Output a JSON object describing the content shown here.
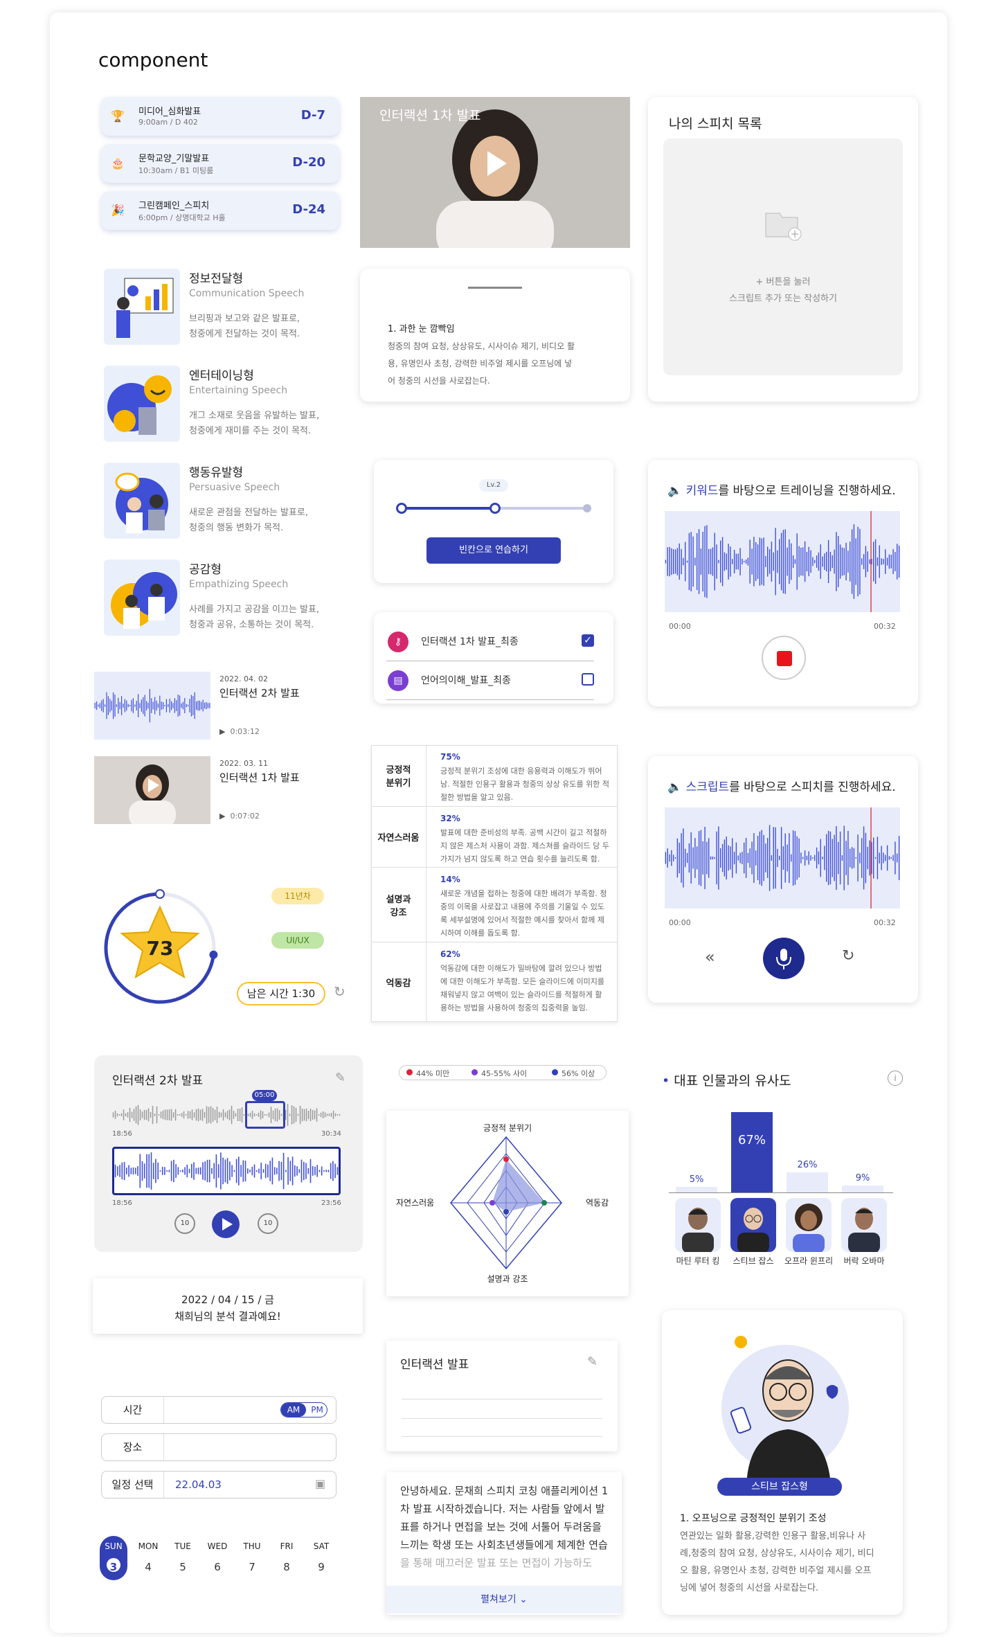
{
  "header": {
    "title": "component"
  },
  "schedules": [
    {
      "name": "미디어_심화발표",
      "sub": "9:00am / D 402",
      "dday": "D-7",
      "icon": "trophy-icon"
    },
    {
      "name": "문학교양_기말발표",
      "sub": "10:30am / B1 미팅룸",
      "dday": "D-20",
      "icon": "cake-icon"
    },
    {
      "name": "그린캠페인_스피치",
      "sub": "6:00pm / 상명대학교 H홀",
      "dday": "D-24",
      "icon": "party-icon"
    }
  ],
  "speech_types": [
    {
      "title": "정보전달형",
      "en": "Communication Speech",
      "desc1": "브리핑과 보고와 같은 발표로,",
      "desc2": "청중에게 전달하는 것이 목적."
    },
    {
      "title": "엔터테이닝형",
      "en": "Entertaining Speech",
      "desc1": "개그 소재로 웃음을 유발하는 발표,",
      "desc2": "청중에게 재미를 주는 것이 목적."
    },
    {
      "title": "행동유발형",
      "en": "Persuasive Speech",
      "desc1": "새로운 관점을 전달하는 발표로,",
      "desc2": "청중의 행동 변화가 목적."
    },
    {
      "title": "공감형",
      "en": "Empathizing Speech",
      "desc1": "사례를 가지고 공감을 이끄는 발표,",
      "desc2": "청중과 공유, 소통하는 것이 목적."
    }
  ],
  "recordings": [
    {
      "date": "2022. 04. 02",
      "title": "인터랙션 2차 발표",
      "duration": "0:03:12"
    },
    {
      "date": "2022. 03. 11",
      "title": "인터랙션 1차 발표",
      "duration": "0:07:02"
    }
  ],
  "score": {
    "value": "73",
    "level": 0.73
  },
  "tags": {
    "grade": "11년차",
    "category": "UI/UX",
    "remaining": "남은 시간 1:30"
  },
  "editor": {
    "title": "인터랙션 2차 발표",
    "badge": "05:00",
    "t1_start": "18:56",
    "t1_end": "30:34",
    "t2_start": "18:56",
    "t2_end": "23:56",
    "rewind": "10",
    "forward": "10"
  },
  "result_card": {
    "date": "2022 / 04 / 15 / 금",
    "msg": "채희님의 분석 결과예요!"
  },
  "form": {
    "time_label": "시간",
    "am": "AM",
    "pm": "PM",
    "place_label": "장소",
    "date_label": "일정 선택",
    "date_value": "22.04.03"
  },
  "calendar": {
    "days": [
      "SUN",
      "MON",
      "TUE",
      "WED",
      "THU",
      "FRI",
      "SAT"
    ],
    "nums": [
      "3",
      "4",
      "5",
      "6",
      "7",
      "8",
      "9"
    ]
  },
  "video": {
    "title": "인터랙션 1차 발표"
  },
  "tip_card": {
    "title": "1. 과한 눈 깜빡임",
    "l1": "청중의 참여 요청, 상상유도, 시사이슈 제기, 비디오 활",
    "l2": "용, 유명인사 초청, 강력한 비주얼 제시를 오프닝에 넣",
    "l3": "어 청중의 시선을 사로잡는다."
  },
  "level": {
    "label": "Lv.2",
    "button": "빈칸으로 연습하기",
    "progress": 0.5
  },
  "checklist": [
    {
      "label": "인터랙션 1차 발표_최종",
      "checked": true,
      "icon": "key-icon"
    },
    {
      "label": "언어의이해_발표_최종",
      "checked": false,
      "icon": "doc-icon"
    }
  ],
  "analysis": [
    {
      "label1": "긍정적",
      "label2": "분위기",
      "pct": "75%",
      "l1": "긍정적 분위기 조성에 대한 응용력과 이해도가 뛰어",
      "l2": "남. 적절한 인용구 활용과 청중의 상상 유도를 위한 적",
      "l3": "절한 방법을 알고 있음.",
      "l4": ""
    },
    {
      "label1": "자연스러움",
      "label2": "",
      "pct": "32%",
      "l1": "발표에 대한 준비성의 부족. 공백 시간이 길고 적절하",
      "l2": "지 않은 제스처 사용이 과함. 제스쳐를 슬라이드 당 두",
      "l3": "가지가 넘지 않도록 하고 연습 횟수를 늘리도록 함.",
      "l4": ""
    },
    {
      "label1": "설명과",
      "label2": "강조",
      "pct": "14%",
      "l1": "새로운 개념을 접하는 청중에 대한 배려가 부족함. 청",
      "l2": "중의 이목을 사로잡고 내용에 주의를 기울일 수 있도",
      "l3": "록 세부설명에 있어서 적절한 예시를 찾아서 함께 제",
      "l4": "시하여 이해를 돕도록 함."
    },
    {
      "label1": "억동감",
      "label2": "",
      "pct": "62%",
      "l1": "억동감에 대한 이해도가 밀바탕에 깔려 있으나 방법",
      "l2": "에 대한 이해도가 부족함. 모든 슬라이드에 이미지를",
      "l3": "채워넣지 않고 여백이 있는 슬라이드를 적절하게 활",
      "l4": "용하는 방법을 사용하여 청중의 집중력을 높임."
    }
  ],
  "legend": [
    {
      "label": "44% 미만",
      "color": "#d6283a"
    },
    {
      "label": "45-55% 사이",
      "color": "#7a3fd1"
    },
    {
      "label": "56% 이상",
      "color": "#3340b4"
    }
  ],
  "radar": {
    "top": "긍정적 분위기",
    "left": "자연스러움",
    "right": "역동감",
    "bottom": "설명과 강조"
  },
  "note": {
    "title": "인터랙션 발표"
  },
  "script": {
    "l1": "안녕하세요. 문채희 스피치 코칭 애플리케이션 1",
    "l2": "차 발표 시작하겠습니다. 저는 사람들 앞에서 발",
    "l3": "표를 하거나 면접을 보는 것에 서툴어 두려움을",
    "l4": "느끼는 학생 또는 사회초년생들에게 체계한 연습",
    "l5": "을 통해 매끄러운 발표 또는 면접이 가능하도",
    "more": "펼쳐보기"
  },
  "speech_list": {
    "title": "나의 스피치 목록",
    "hint1": "+ 버튼을 눌러",
    "hint2": "스크립트 추가 또는 작성하기"
  },
  "keyword_rec": {
    "keyword": "키워드",
    "rest": "를 바탕으로 트레이닝을 진행하세요.",
    "start": "00:00",
    "end": "00:32"
  },
  "script_rec": {
    "keyword": "스크립트",
    "rest": "를 바탕으로 스피치를 진행하세요.",
    "start": "00:00",
    "end": "00:32"
  },
  "similarity": {
    "title": "대표 인물과의 유사도",
    "people": [
      {
        "name": "마틴 루터 킹",
        "pct": "5%",
        "value": 5
      },
      {
        "name": "스티브 잡스",
        "pct": "67%",
        "value": 67
      },
      {
        "name": "오프라 윈프리",
        "pct": "26%",
        "value": 26
      },
      {
        "name": "버락 오바마",
        "pct": "9%",
        "value": 9
      }
    ]
  },
  "persona": {
    "name": "스티브 잡스형",
    "title": "1. 오프닝으로 긍정적인 분위기 조성",
    "l1": "연관있는 일화 활용,강력한 인용구 활용,비유나 사",
    "l2": "례,청중의 참여 요청, 상상유도, 시사이슈 제기, 비디",
    "l3": "오 활용, 유명인사 초청, 강력한 비주얼 제시를 오프",
    "l4": "닝에 넣어 청중의 시선을 사로잡는다."
  },
  "colors": {
    "accent": "#3340b4",
    "light": "#eef2fb",
    "record": "#e8141c"
  }
}
